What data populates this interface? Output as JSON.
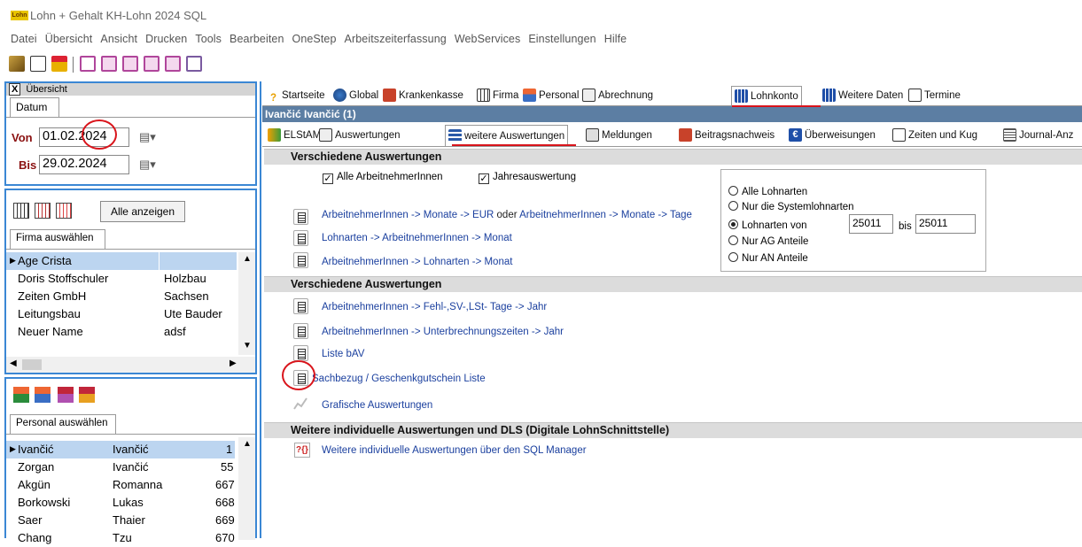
{
  "app": {
    "logo_text": "Lohn",
    "title": "Lohn + Gehalt KH-Lohn 2024 SQL"
  },
  "menu": [
    "Datei",
    "Übersicht",
    "Ansicht",
    "Drucken",
    "Tools",
    "Bearbeiten",
    "OneStep",
    "Arbeitszeiterfassung",
    "WebServices",
    "Einstellungen",
    "Hilfe"
  ],
  "overview": {
    "close_glyph": "X",
    "title": "Übersicht",
    "date_tab": "Datum",
    "from_label": "Von",
    "from_value": "01.02.2024",
    "to_label": "Bis",
    "to_value": "29.02.2024",
    "calendar_glyph": "▤▾"
  },
  "firm_panel": {
    "show_all_button": "Alle anzeigen",
    "tab": "Firma auswählen",
    "rows": [
      {
        "name": "Age Crista",
        "place": ""
      },
      {
        "name": "Doris Stoffschuler",
        "place": "Holzbau"
      },
      {
        "name": "Zeiten GmbH",
        "place": "Sachsen"
      },
      {
        "name": "Leitungsbau",
        "place": "Ute Bauder"
      },
      {
        "name": "Neuer Name",
        "place": "adsf"
      }
    ]
  },
  "personal_panel": {
    "tab": "Personal auswählen",
    "rows": [
      {
        "last": "Ivančić",
        "first": "Ivančić",
        "nr": "1"
      },
      {
        "last": "Zorgan",
        "first": "Ivančić",
        "nr": "55"
      },
      {
        "last": "Akgün",
        "first": "Romanna",
        "nr": "667"
      },
      {
        "last": "Borkowski",
        "first": "Lukas",
        "nr": "668"
      },
      {
        "last": "Saer",
        "first": "Thaier",
        "nr": "669"
      },
      {
        "last": "Chang",
        "first": "Tzu",
        "nr": "670"
      }
    ]
  },
  "main_tabs": [
    "Startseite",
    "Global",
    "Krankenkasse",
    "Firma",
    "Personal",
    "Abrechnung",
    "Lohnkonto",
    "Weitere Daten",
    "Termine"
  ],
  "employee_header": "Ivančić Ivančić (1)",
  "sub_tabs": [
    "ELStAM",
    "Auswertungen",
    "weitere Auswertungen",
    "Meldungen",
    "Beitragsnachweis",
    "Überweisungen",
    "Zeiten und Kug",
    "Journal-Anz"
  ],
  "section1": {
    "title": "Verschiedene Auswertungen",
    "check_all_employees": "Alle ArbeitnehmerInnen",
    "check_year": "Jahresauswertung",
    "report1_a": "ArbeitnehmerInnen -> Monate -> EUR",
    "report1_or": "oder",
    "report1_b": "ArbeitnehmerInnen -> Monate -> Tage",
    "report2": "Lohnarten -> ArbeitnehmerInnen -> Monat",
    "report3": "ArbeitnehmerInnen -> Lohnarten -> Monat",
    "radio_all": "Alle Lohnarten",
    "radio_system": "Nur die Systemlohnarten",
    "radio_from": "Lohnarten von",
    "from_value": "25011",
    "to_label": "bis",
    "to_value": "25011",
    "radio_ag": "Nur AG Anteile",
    "radio_an": "Nur AN Anteile"
  },
  "section2": {
    "title": "Verschiedene Auswertungen",
    "report1": "ArbeitnehmerInnen -> Fehl-,SV-,LSt- Tage -> Jahr",
    "report2": "ArbeitnehmerInnen -> Unterbrechnungszeiten -> Jahr",
    "report3": "Liste bAV",
    "report4": "Sachbezug / Geschenkgutschein Liste",
    "report5": "Grafische Auswertungen"
  },
  "section3": {
    "title": "Weitere individuelle Auswertungen und DLS  (Digitale LohnSchnittstelle)",
    "icon_text": "?{}",
    "report1": "Weitere individuelle Auswertungen über den SQL Manager"
  },
  "colors": {
    "selection": "#bcd5f0",
    "panel_border": "#3b87d4",
    "link": "#1a3f9e",
    "annotation": "#d9141b"
  }
}
